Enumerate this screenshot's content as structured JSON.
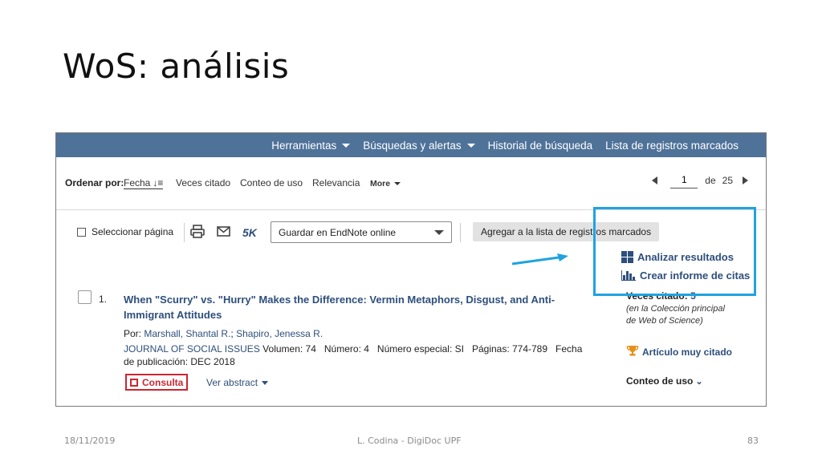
{
  "slide": {
    "title": "WoS: análisis",
    "footer_date": "18/11/2019",
    "footer_author": "L. Codina - DigiDoc UPF",
    "footer_page": "83"
  },
  "topnav": {
    "tools": "Herramientas",
    "searches_alerts": "Búsquedas y alertas",
    "history": "Historial de búsqueda",
    "marked_list": "Lista de registros marcados"
  },
  "sortbar": {
    "label": "Ordenar por:",
    "options": [
      "Fecha",
      "Veces citado",
      "Conteo de uso",
      "Relevancia",
      "More"
    ],
    "page_current": "1",
    "page_of": "de",
    "page_total": "25"
  },
  "toolbar": {
    "select_page": "Seleccionar página",
    "five_k": "5K",
    "save_option": "Guardar en EndNote online",
    "add_marked": "Agregar a la lista de registros marcados",
    "analyze": "Analizar resultados",
    "citation_report": "Crear informe de citas"
  },
  "record": {
    "number": "1.",
    "title": "When \"Scurry\" vs. \"Hurry\" Makes the Difference: Vermin Metaphors, Disgust, and Anti-Immigrant Attitudes",
    "by_label": "Por:",
    "author1": "Marshall, Shantal R.",
    "author_sep": ";",
    "author2": "Shapiro, Jenessa R.",
    "journal": "JOURNAL OF SOCIAL ISSUES",
    "details": "Volumen: 74   Número: 4   Número especial: SI   Páginas: 774-789   Fecha de publicación: DEC 2018",
    "consulta": "Consulta",
    "abstract": "Ver abstract",
    "times_cited_label": "Veces citado:",
    "times_cited_count": "5",
    "collection_line1": "(en la Colección principal",
    "collection_line2": "de Web of Science)",
    "highly_cited": "Artículo muy citado",
    "usage": "Conteo de uso"
  },
  "colors": {
    "nav_bar": "#4f7299",
    "link": "#2e4f7c",
    "highlight": "#1fa3e0",
    "consulta_red": "#cc2631",
    "trophy": "#e8901a"
  }
}
